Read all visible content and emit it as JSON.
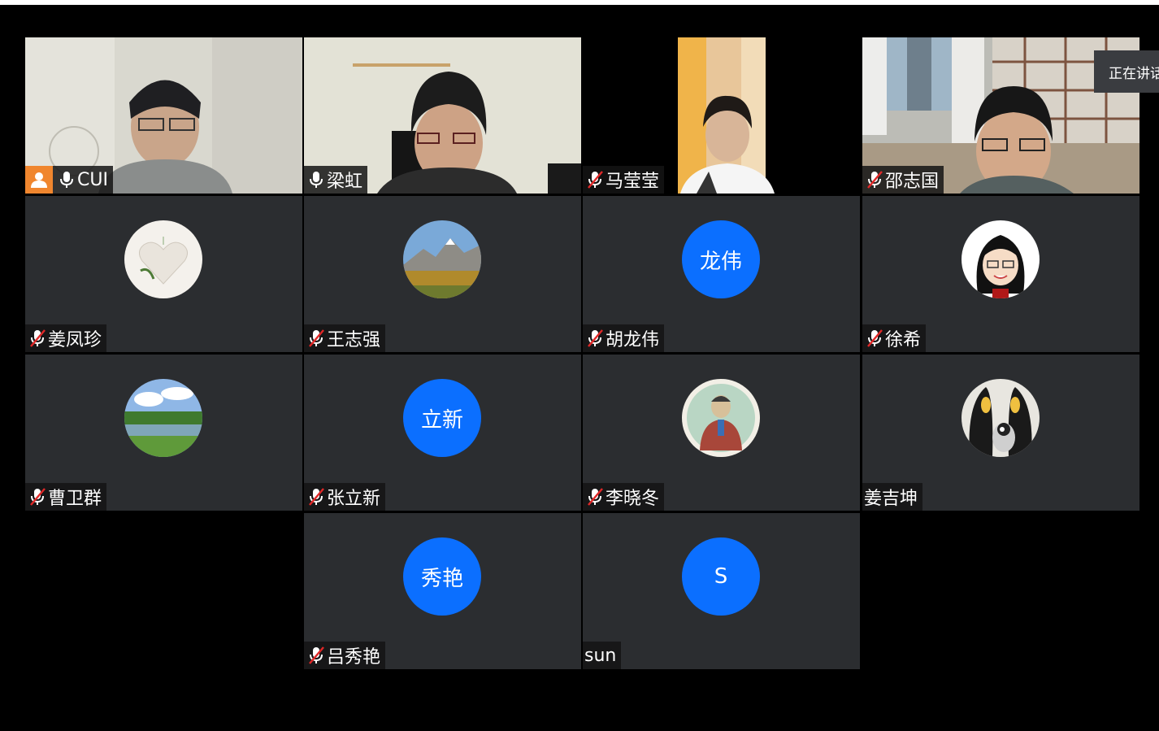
{
  "speaking_indicator": "正在讲话",
  "participants": [
    {
      "name": "CUI",
      "host": true,
      "muted": false
    },
    {
      "name": "梁虹",
      "muted": false
    },
    {
      "name": "马莹莹",
      "muted": true
    },
    {
      "name": "邵志国",
      "muted": true
    },
    {
      "name": "姜凤珍",
      "muted": true,
      "avatar": "heart-sign-photo"
    },
    {
      "name": "王志强",
      "muted": true,
      "avatar": "mountain-photo"
    },
    {
      "name": "胡龙伟",
      "muted": true,
      "initials": "龙伟"
    },
    {
      "name": "徐希",
      "muted": true,
      "avatar": "cartoon-woman"
    },
    {
      "name": "曹卫群",
      "muted": true,
      "avatar": "lake-photo"
    },
    {
      "name": "张立新",
      "muted": true,
      "initials": "立新"
    },
    {
      "name": "李晓冬",
      "muted": true,
      "avatar": "drawing-portrait"
    },
    {
      "name": "姜吉坤",
      "muted": false,
      "no_mic_icon": true,
      "avatar": "penguin-photo"
    },
    {
      "name": "吕秀艳",
      "muted": true,
      "initials": "秀艳"
    },
    {
      "name": "sun",
      "muted": false,
      "no_mic_icon": true,
      "initials": "S"
    }
  ],
  "colors": {
    "avatar_blue": "#0b6fff",
    "host_orange": "#f0862e",
    "tile_bg": "#2b2d30"
  }
}
